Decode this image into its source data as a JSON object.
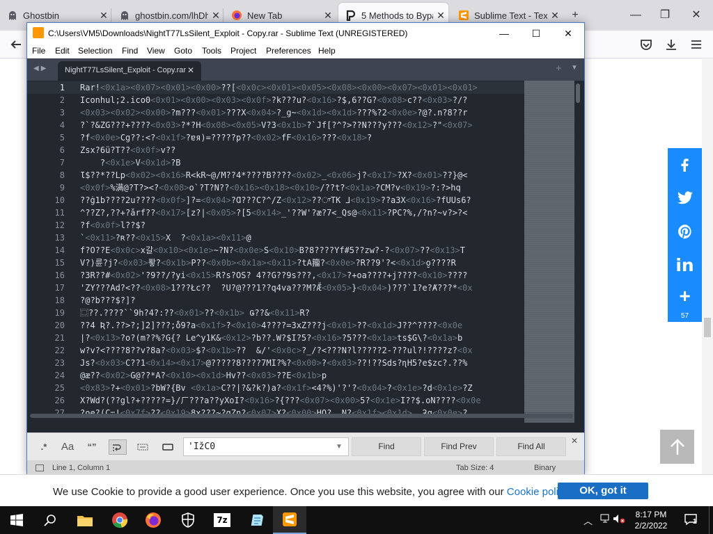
{
  "browser": {
    "tabs": [
      {
        "title": "Ghostbin",
        "icon": "ghost-icon",
        "active": false
      },
      {
        "title": "ghostbin.com/lhDh",
        "icon": "ghost-icon",
        "active": false
      },
      {
        "title": "New Tab",
        "icon": "firefox-icon",
        "active": false
      },
      {
        "title": "5 Methods to Bypa",
        "icon": "p-logo-icon",
        "active": true
      },
      {
        "title": "Sublime Text - Text",
        "icon": "sublime-icon",
        "active": false
      }
    ],
    "new_tab_label": "+",
    "close_glyph": "✕"
  },
  "page": {
    "share_count": "57",
    "cookie_text": "We use Cookie to provide a good user experience. Once you use this website, you agree with our ",
    "cookie_link": "Cookie policy",
    "cookie_period": ".",
    "cookie_ok": "OK, got it"
  },
  "sublime": {
    "title": "C:\\Users\\VM5\\Downloads\\NightT77LsSilent_Exploit - Copy.rar - Sublime Text (UNREGISTERED)",
    "menu": [
      "File",
      "Edit",
      "Selection",
      "Find",
      "View",
      "Goto",
      "Tools",
      "Project",
      "Preferences",
      "Help"
    ],
    "tab_name": "NightT77LsSilent_Exploit - Copy.rar",
    "lines": [
      "Rar!<0x1a><0x07><0x01><0x00>??[<0x0c><0x01><0x05><0x08><0x00><0x07><0x01><0x01>",
      "Iconhul;2.ico0<0x01><0x00><0x03><0x0f>?k???u?<0x16>?$,6??G?<0x08>c??<0x03>?/?",
      "<0x03><0x02><0x00>?m???<0x01>???X<0x04>?_g~<0x1d><0x1d>???%?2<0x0e>?@?.n?8??r",
      "?`?&ZG???+????<0x03>?*?H<0x08><0x05>V?3<0x1b>?`Jf[?^?>??N???y???<0x12>?\"<0x07>",
      "?f<0x0e>Cg??:<?<0x1f>?ɐя)=?????p??<0x02>fF<0x16>???<0x18>?",
      "Zsx?6ü?T??<0x0f>v??",
      "    ?<0x1e>V<0x1d>?B",
      "Ɩ$??*??Lp<0x02><0x16>R<kR~@/M??4*????B????<0x02>_<0x06>j?<0x17>?X?<0x01>??}@<",
      "<0x0f>%满@?T?><?<0x08>o`?T?N??<0x16><0x18><0x10>/??t?<0x1a>?CM?v<0x19>?:?>hq",
      "??ġ1b????2u????<0x0f>]?=<0x04>?Ɑ???C?^/Z<0x12>??ਾTK ⅃<0x19>??a3X<0x16>?fUUs6?",
      "^??Z?,??+?ǎrf??<0x17>[z?|<0x05>?[5<0x14>_'??W'?æ?7<_Qs@<0x11>?PC?%,/?n?~v?>?<",
      "?f<0x0f>l??$?",
      "`<0x11>?ʀ??<0x15>X  ?<0x1a><0x11>@",
      "f?O??E<0x0c>x갈<0x10><0x1e>~?N?<0x0e>S<0x10>B?8????Yf#5??zw?-?<0x07>??<0x13>T",
      "V?)륜?j?<0x03>퐣?<0x1b>P??<0x0b><0x1a><0x11>?tA籀?<0x0e>?R??9'?<<0x1d>o̮????R",
      "?3R??#<0x02>'?9??/?yi<0x15>R?s?OS? 4??G??9s???,<0x17>?+oa????+j????<0x10>????",
      "'ZY???Ad?<??<0x08>1???Łc??  ?U?@???1??q4va???M?Ǣ<0x05>}<0x04>)???`1?e?Ⱥ???*<0x",
      "?@?b???$?]?",
      "⿴??.????``9h?4?:??<0x01>??<0x1b> Ǥ??&<0x11>R?",
      "??4 Ʀ?.??>?;]2]???;o̐̆9?a<0x1f>?<0x10>4????=3xZ???j<0x01>??<0x1d>J??^????<0x0e",
      "|?<0x13>?o?(m??%?G{? Le^y1K&<0x12>?b??.W?$I?5?<0x16>?5???<0x1a>ts$G\\?<0x1a>b",
      "w?v?<????8??v?8a?<0x03>$?<0x1b>??  &/'<0x0c>?_/?<???N?l?????2-???ul?!????z?<0x",
      "Js?<0x03>C??1<0x14><0x17>@?????8????7MI?%?<0x00>?<0x03>??!??Sds?ɳH5?e$zc?.??%",
      "@æ??<0x02>G@??*A?<0x10><0x1d>Hv??<0x03>??E<0x1b>p",
      "<0x83>?+<0x01>?bW?{Bv <0x1a>C??|?&?k?)a?<0x1f><4?%)'?'?<0x04>?<0x1e>?d<0x1e>?Z",
      "X?Wd?(??gl?+?????=}/ㄏ???a??yXoI?<0x16>?{???<0x07><0x00>5?<0x1e>I??$.oN????<0x0e",
      "?ǫe?(C=!<0x7f>??<0x19>8ɣ???~?gZn?<0x07>X?<0x00>HQ?  N?<0x1f><0x1d>  ƻq<0x0e>?"
    ],
    "find": {
      "options": [
        ".*",
        "Aa",
        "“”",
        "wrap",
        "selection",
        "highlight"
      ],
      "query": "'IžC0",
      "buttons": [
        "Find",
        "Find Prev",
        "Find All"
      ]
    },
    "status": {
      "position": "Line 1, Column 1",
      "tab_size": "Tab Size: 4",
      "encoding": "Binary"
    }
  },
  "taskbar": {
    "time": "8:17 PM",
    "date": "2/2/2022",
    "notif_count": "1"
  },
  "colors": {
    "sublime_bg": "#23282e",
    "share_blue": "#1a8cff",
    "cookie_button": "#1a6fc4"
  }
}
